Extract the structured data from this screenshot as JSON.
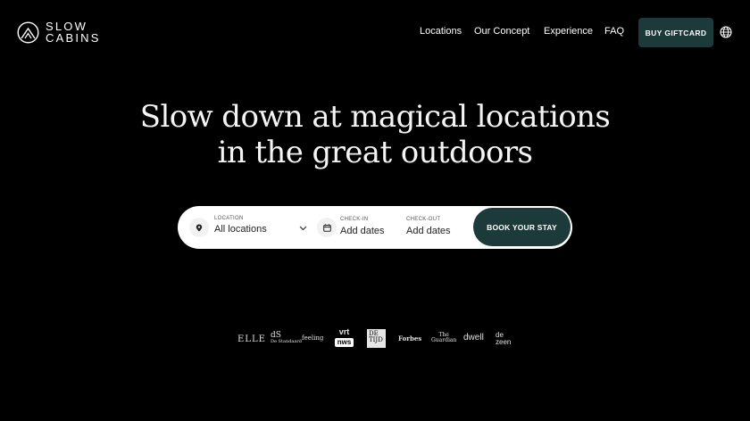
{
  "brand": {
    "line1": "SLOW",
    "line2": "CABINS",
    "logo_icon": "cabin-circle-logo"
  },
  "nav": {
    "items": [
      {
        "label": "Locations"
      },
      {
        "label": "Our Concept"
      },
      {
        "label": "Experience"
      },
      {
        "label": "FAQ"
      }
    ],
    "giftcard_label": "BUY GIFTCARD",
    "language_icon": "globe-icon"
  },
  "hero": {
    "title_line1": "Slow down at magical locations",
    "title_line2": "in the great outdoors"
  },
  "search": {
    "location_label": "LOCATION",
    "location_value": "All locations",
    "checkin_label": "CHECK-IN",
    "checkin_value": "Add dates",
    "checkout_label": "CHECK-OUT",
    "checkout_value": "Add dates",
    "book_label": "BOOK YOUR STAY"
  },
  "press": {
    "elle": "ELLE",
    "ds_line1": "dS",
    "ds_line2": "De Standaard",
    "feeling": "feeling",
    "vrt": "vrt",
    "nws": "nws",
    "tijd_line1": "DE",
    "tijd_line2": "TIJD",
    "forbes": "Forbes",
    "guardian_line1": "The",
    "guardian_line2": "Guardian",
    "dwell": "dwell",
    "dezeen_line1": "de",
    "dezeen_line2": "zeen"
  },
  "colors": {
    "background": "#000000",
    "accent": "#1d3a3a",
    "search_bg": "#ffffff"
  }
}
